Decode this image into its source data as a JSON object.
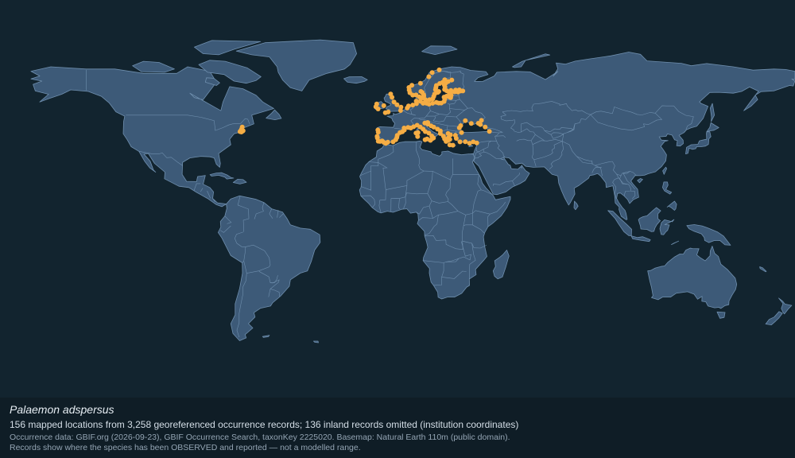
{
  "map": {
    "basemap_color": "#3d5a78",
    "ocean_color": "#12242f",
    "marker_color": "#f5ad44",
    "occurrences": [
      [
        -3.1,
        58.6
      ],
      [
        -2.5,
        57.1
      ],
      [
        -1.6,
        55.0
      ],
      [
        -0.2,
        53.7
      ],
      [
        1.6,
        52.6
      ],
      [
        1.4,
        51.1
      ],
      [
        -4.2,
        50.4
      ],
      [
        -5.5,
        50.1
      ],
      [
        -6.2,
        53.3
      ],
      [
        -9.4,
        54.1
      ],
      [
        -9.8,
        52.8
      ],
      [
        -8.8,
        51.8
      ],
      [
        4.4,
        52.2
      ],
      [
        5.0,
        53.2
      ],
      [
        6.9,
        53.6
      ],
      [
        8.6,
        54.2
      ],
      [
        8.5,
        55.4
      ],
      [
        10.4,
        55.3
      ],
      [
        10.6,
        56.7
      ],
      [
        9.8,
        57.4
      ],
      [
        11.9,
        57.7
      ],
      [
        12.6,
        56.1
      ],
      [
        11.6,
        54.4
      ],
      [
        13.1,
        54.4
      ],
      [
        14.3,
        54.0
      ],
      [
        15.9,
        54.4
      ],
      [
        17.6,
        54.8
      ],
      [
        18.7,
        54.5
      ],
      [
        19.8,
        54.5
      ],
      [
        21.1,
        55.2
      ],
      [
        21.4,
        56.2
      ],
      [
        21.1,
        57.2
      ],
      [
        22.2,
        57.6
      ],
      [
        23.4,
        57.3
      ],
      [
        24.1,
        57.0
      ],
      [
        24.3,
        58.0
      ],
      [
        23.5,
        58.8
      ],
      [
        24.3,
        59.5
      ],
      [
        25.9,
        59.6
      ],
      [
        27.4,
        59.5
      ],
      [
        28.6,
        60.0
      ],
      [
        29.6,
        60.0
      ],
      [
        28.0,
        60.5
      ],
      [
        26.3,
        60.4
      ],
      [
        24.2,
        60.2
      ],
      [
        22.3,
        60.1
      ],
      [
        21.3,
        60.7
      ],
      [
        21.5,
        61.8
      ],
      [
        21.2,
        62.8
      ],
      [
        21.8,
        63.6
      ],
      [
        22.9,
        64.3
      ],
      [
        24.6,
        65.0
      ],
      [
        21.4,
        65.1
      ],
      [
        20.4,
        63.9
      ],
      [
        19.1,
        63.4
      ],
      [
        17.6,
        62.5
      ],
      [
        17.4,
        61.5
      ],
      [
        17.2,
        60.6
      ],
      [
        18.7,
        59.8
      ],
      [
        18.2,
        59.3
      ],
      [
        16.8,
        58.6
      ],
      [
        16.4,
        57.5
      ],
      [
        16.0,
        56.4
      ],
      [
        14.5,
        56.0
      ],
      [
        12.9,
        55.5
      ],
      [
        11.3,
        56.9
      ],
      [
        11.8,
        58.3
      ],
      [
        11.2,
        59.3
      ],
      [
        10.6,
        59.8
      ],
      [
        8.4,
        58.2
      ],
      [
        6.9,
        58.1
      ],
      [
        5.6,
        59.2
      ],
      [
        5.3,
        60.4
      ],
      [
        5.2,
        61.6
      ],
      [
        6.5,
        62.6
      ],
      [
        10.4,
        63.5
      ],
      [
        14.2,
        66.5
      ],
      [
        15.7,
        68.4
      ],
      [
        18.9,
        69.6
      ],
      [
        -8.9,
        42.2
      ],
      [
        -8.7,
        41.2
      ],
      [
        -9.2,
        39.3
      ],
      [
        -9.1,
        38.6
      ],
      [
        -8.7,
        37.1
      ],
      [
        -7.9,
        37.0
      ],
      [
        -6.9,
        37.2
      ],
      [
        -6.2,
        36.6
      ],
      [
        -5.3,
        36.1
      ],
      [
        -4.4,
        36.7
      ],
      [
        -2.0,
        36.8
      ],
      [
        -0.8,
        37.8
      ],
      [
        -0.3,
        38.8
      ],
      [
        -0.1,
        39.8
      ],
      [
        1.1,
        41.0
      ],
      [
        2.2,
        41.4
      ],
      [
        3.1,
        42.2
      ],
      [
        3.0,
        43.1
      ],
      [
        4.8,
        43.4
      ],
      [
        6.0,
        43.1
      ],
      [
        7.3,
        43.7
      ],
      [
        8.9,
        44.4
      ],
      [
        10.3,
        43.6
      ],
      [
        11.6,
        42.6
      ],
      [
        12.6,
        41.5
      ],
      [
        14.2,
        40.8
      ],
      [
        15.5,
        39.5
      ],
      [
        16.3,
        38.6
      ],
      [
        15.6,
        38.2
      ],
      [
        14.9,
        37.5
      ],
      [
        13.4,
        38.1
      ],
      [
        12.5,
        37.8
      ],
      [
        9.1,
        39.2
      ],
      [
        8.4,
        40.8
      ],
      [
        9.3,
        41.0
      ],
      [
        13.7,
        45.6
      ],
      [
        12.4,
        45.4
      ],
      [
        13.8,
        44.9
      ],
      [
        15.2,
        44.1
      ],
      [
        16.4,
        43.5
      ],
      [
        18.1,
        42.6
      ],
      [
        19.4,
        41.8
      ],
      [
        19.4,
        40.6
      ],
      [
        20.8,
        39.4
      ],
      [
        21.3,
        38.2
      ],
      [
        22.0,
        37.0
      ],
      [
        22.9,
        37.5
      ],
      [
        23.7,
        37.9
      ],
      [
        23.0,
        38.6
      ],
      [
        24.0,
        40.0
      ],
      [
        22.9,
        40.6
      ],
      [
        23.7,
        35.4
      ],
      [
        25.1,
        35.3
      ],
      [
        26.2,
        39.8
      ],
      [
        26.6,
        38.4
      ],
      [
        28.3,
        36.8
      ],
      [
        30.7,
        36.9
      ],
      [
        32.6,
        36.2
      ],
      [
        34.3,
        36.8
      ],
      [
        35.9,
        36.3
      ],
      [
        29.0,
        41.0
      ],
      [
        28.0,
        43.2
      ],
      [
        28.6,
        44.2
      ],
      [
        30.7,
        46.5
      ],
      [
        33.4,
        45.2
      ],
      [
        36.6,
        45.3
      ],
      [
        38.0,
        46.6
      ],
      [
        37.5,
        44.7
      ],
      [
        39.7,
        43.6
      ],
      [
        41.6,
        41.6
      ],
      [
        -70.6,
        42.6
      ],
      [
        -70.9,
        42.0
      ],
      [
        -70.1,
        41.7
      ],
      [
        -71.3,
        41.5
      ],
      [
        -70.7,
        41.3
      ],
      [
        -69.9,
        41.9
      ],
      [
        -70.3,
        43.6
      ]
    ]
  },
  "caption": {
    "title": "Palaemon adspersus",
    "summary": "156 mapped locations from 3,258 georeferenced occurrence records; 136 inland records omitted (institution coordinates)",
    "source": "Occurrence data: GBIF.org (2026-09-23), GBIF Occurrence Search, taxonKey 2225020. Basemap: Natural Earth 110m (public domain).",
    "disclaimer": "Records show where the species has been OBSERVED and reported — not a modelled range."
  }
}
